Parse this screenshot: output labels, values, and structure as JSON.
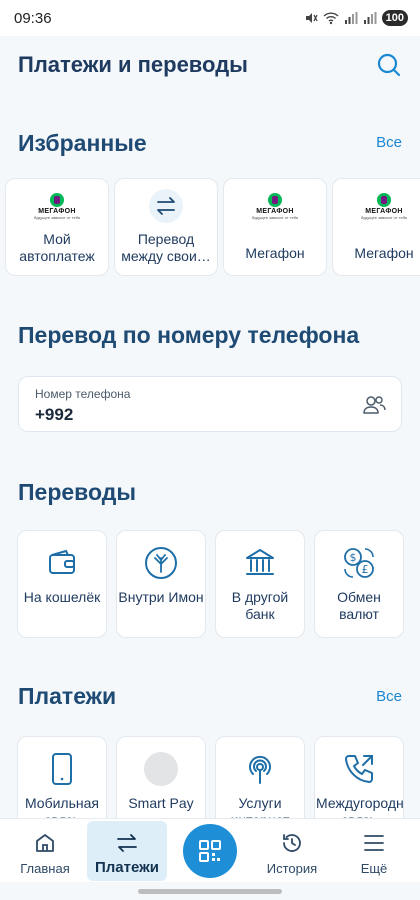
{
  "status_bar": {
    "time": "09:36",
    "battery": "100"
  },
  "header": {
    "title": "Платежи и переводы"
  },
  "favorites": {
    "title": "Избранные",
    "see_all": "Все",
    "items": [
      {
        "label": "Мой автоплатеж",
        "icon": "megafon-logo"
      },
      {
        "label": "Перевод между свои…",
        "icon": "transfer-arrows-icon"
      },
      {
        "label": "Мегафон",
        "icon": "megafon-logo"
      },
      {
        "label": "Мегафон",
        "icon": "megafon-logo"
      }
    ],
    "logo_text": "МЕГАФОН",
    "logo_sub": "будущее зависит от тебя"
  },
  "phone_transfer": {
    "title": "Перевод по номеру телефона",
    "field_label": "Номер телефона",
    "field_value": "+992"
  },
  "transfers": {
    "title": "Переводы",
    "items": [
      {
        "label": "На кошелёк",
        "icon": "wallet-icon"
      },
      {
        "label": "Внутри Имон",
        "icon": "imon-logo-icon"
      },
      {
        "label": "В другой банк",
        "icon": "bank-icon"
      },
      {
        "label": "Обмен валют",
        "icon": "currency-exchange-icon"
      }
    ]
  },
  "payments": {
    "title": "Платежи",
    "see_all": "Все",
    "items": [
      {
        "label": "Мобильная связь",
        "icon": "mobile-phone-icon"
      },
      {
        "label": "Smart Pay",
        "icon": "gray-circle-icon"
      },
      {
        "label": "Услуги интернет",
        "icon": "wifi-signal-icon"
      },
      {
        "label": "Междугородняя связь",
        "icon": "phone-outgoing-icon"
      }
    ]
  },
  "bottom_nav": {
    "items": [
      {
        "label": "Главная",
        "icon": "home-icon"
      },
      {
        "label": "Платежи",
        "icon": "transfer-arrows-icon",
        "active": true
      },
      {
        "label": "История",
        "icon": "history-icon"
      },
      {
        "label": "Ещё",
        "icon": "menu-icon"
      }
    ]
  },
  "colors": {
    "accent": "#1E8FD6",
    "title": "#1E4A73",
    "background": "#F4F8FB",
    "active_tab": "#DDEEF9"
  }
}
